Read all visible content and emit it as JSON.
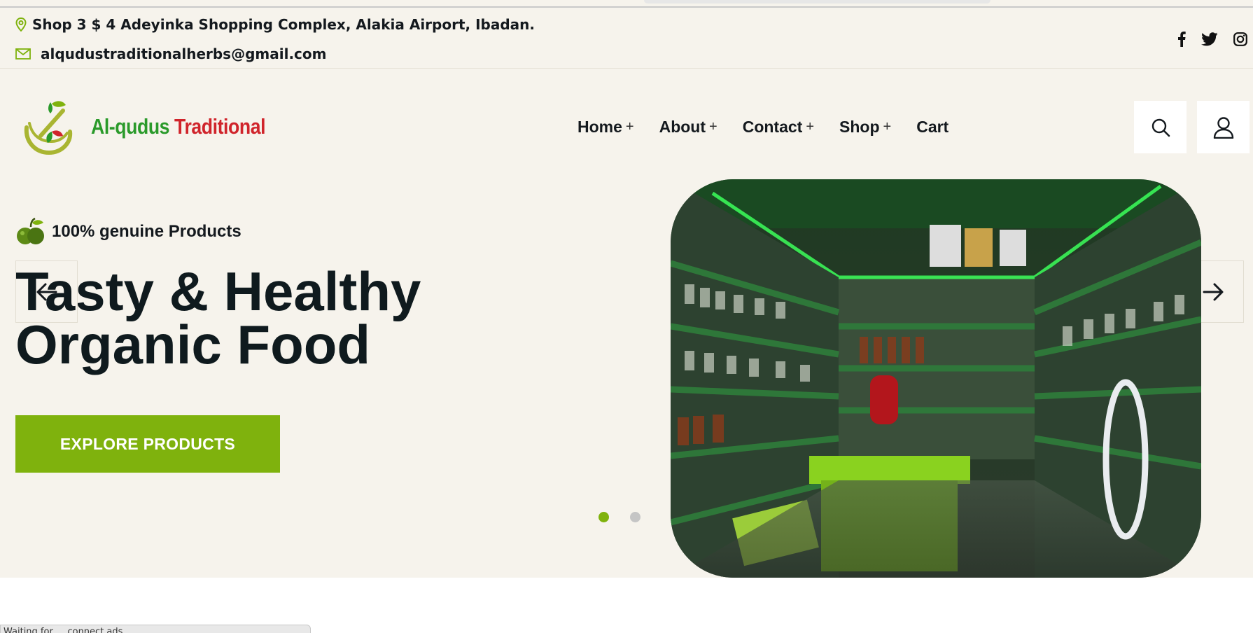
{
  "topbar": {
    "address": "Shop 3 $ 4 Adeyinka Shopping Complex, Alakia Airport, Ibadan.",
    "email": "alqudustraditionalherbs@gmail.com",
    "icons": {
      "address": "map-pin-icon",
      "email": "envelope-icon"
    },
    "socials": [
      "facebook-icon",
      "twitter-icon",
      "instagram-icon"
    ]
  },
  "header": {
    "logo": {
      "word1": "Al-qudus",
      "word2": "Traditional"
    },
    "nav": [
      {
        "label": "Home",
        "suffix": "+"
      },
      {
        "label": "About",
        "suffix": "+"
      },
      {
        "label": "Contact",
        "suffix": "+"
      },
      {
        "label": "Shop",
        "suffix": "+"
      },
      {
        "label": "Cart",
        "suffix": ""
      }
    ],
    "actions": [
      "search-icon",
      "user-icon"
    ]
  },
  "hero": {
    "tagline": "100% genuine Products",
    "title_line1": "Tasty & Healthy",
    "title_line2": "Organic Food",
    "cta_label": "EXPLORE PRODUCTS",
    "slider": {
      "total": 2,
      "active": 1
    }
  },
  "status_bar": {
    "text": "Waiting for ... connect.ads..."
  },
  "colors": {
    "accent": "#7fb20d",
    "background": "#f6f3ec",
    "heading": "#0f1a1e",
    "logo_green": "#2a9a2a",
    "logo_red": "#d0242b"
  }
}
